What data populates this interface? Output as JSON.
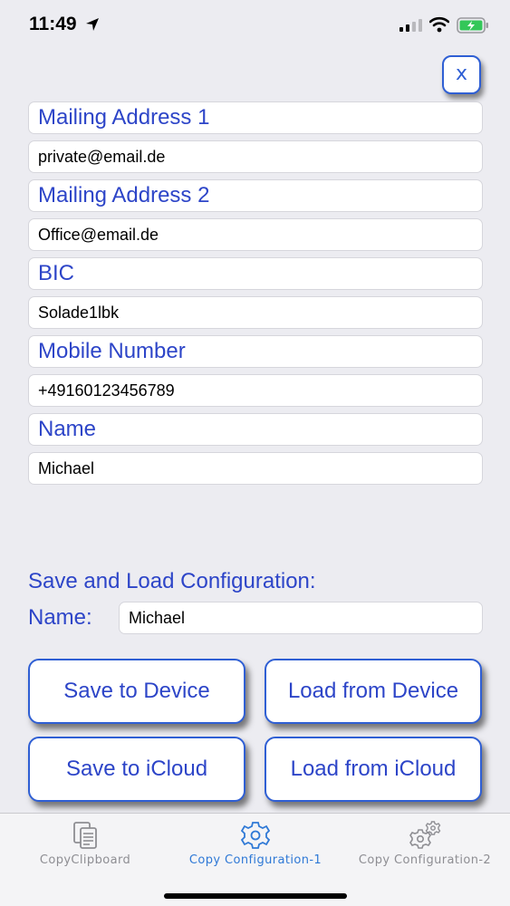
{
  "status_bar": {
    "time": "11:49"
  },
  "close_label": "x",
  "form_fields": [
    {
      "label": "Mailing Address 1",
      "value": "private@email.de"
    },
    {
      "label": "Mailing Address 2",
      "value": "Office@email.de"
    },
    {
      "label": "BIC",
      "value": "Solade1lbk"
    },
    {
      "label": "Mobile Number",
      "value": "+4916012345678​9"
    },
    {
      "label": "Name",
      "value": "Michael"
    }
  ],
  "save_load": {
    "title": "Save and Load Configuration:",
    "name_label": "Name:",
    "name_value": "Michael",
    "save_device": "Save to Device",
    "load_device": "Load from Device",
    "save_icloud": "Save to iCloud",
    "load_icloud": "Load from iCloud"
  },
  "tabs": [
    {
      "label": "CopyClipboard",
      "icon": "clipboard-icon",
      "active": false
    },
    {
      "label": "Copy Configuration-1",
      "icon": "gear-icon",
      "active": true
    },
    {
      "label": "Copy Configuration-2",
      "icon": "gears-icon",
      "active": false
    }
  ],
  "colors": {
    "accent": "#2d45c8",
    "button_border": "#2f5fd4",
    "active_tab": "#2f79d6",
    "inactive_tab": "#8e8e93"
  }
}
